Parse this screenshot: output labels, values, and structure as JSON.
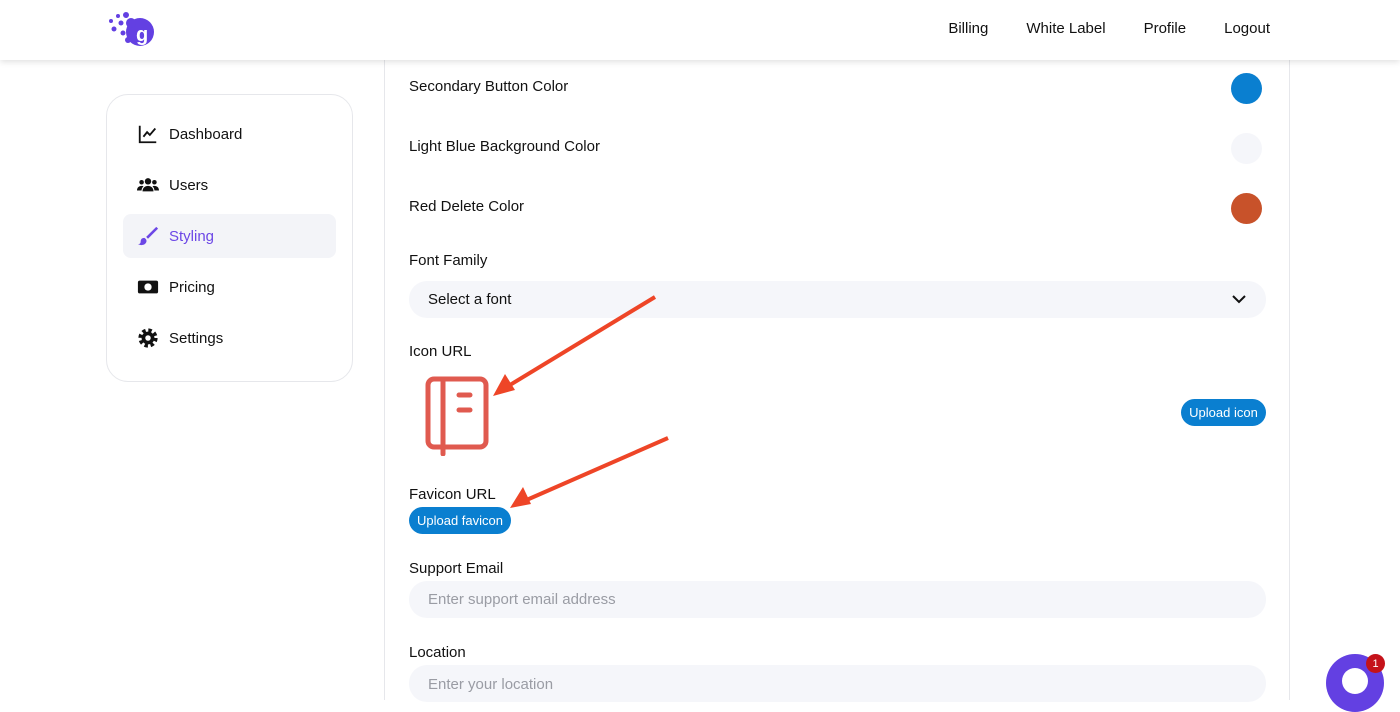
{
  "header": {
    "nav": [
      "Billing",
      "White Label",
      "Profile",
      "Logout"
    ]
  },
  "sidebar": {
    "items": [
      {
        "label": "Dashboard"
      },
      {
        "label": "Users"
      },
      {
        "label": "Styling"
      },
      {
        "label": "Pricing"
      },
      {
        "label": "Settings"
      }
    ]
  },
  "main": {
    "colors": [
      {
        "label": "Secondary Button Color",
        "color": "#0a7fd0"
      },
      {
        "label": "Light Blue Background Color",
        "color": "#f5f6fa"
      },
      {
        "label": "Red Delete Color",
        "color": "#c8522a"
      }
    ],
    "font_family": {
      "label": "Font Family",
      "value": "Select a font"
    },
    "icon_url": {
      "label": "Icon URL",
      "button": "Upload icon"
    },
    "favicon_url": {
      "label": "Favicon URL",
      "button": "Upload favicon"
    },
    "support_email": {
      "label": "Support Email",
      "placeholder": "Enter support email address"
    },
    "location": {
      "label": "Location",
      "placeholder": "Enter your location"
    }
  },
  "chat": {
    "badge": "1"
  }
}
